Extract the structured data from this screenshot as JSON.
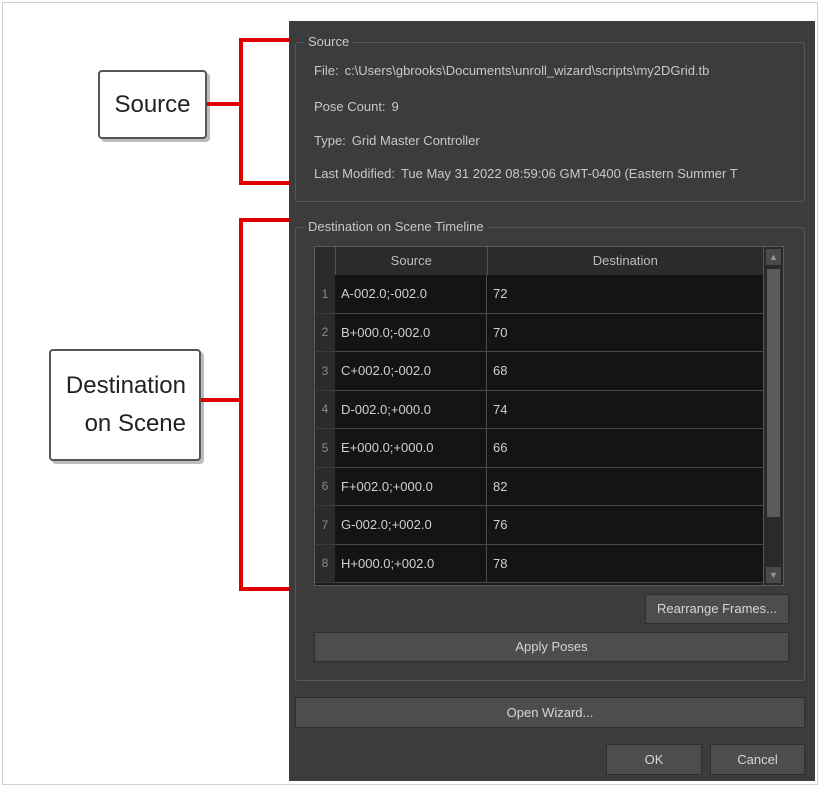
{
  "annotations": {
    "source_label": "Source",
    "destination_line1": "Destination",
    "destination_line2": "on Scene",
    "bracket_color": "#e00000"
  },
  "source_group": {
    "title": "Source",
    "file_label": "File:",
    "file_value": "c:\\Users\\gbrooks\\Documents\\unroll_wizard\\scripts\\my2DGrid.tb",
    "pose_count_label": "Pose Count:",
    "pose_count_value": "9",
    "type_label": "Type:",
    "type_value": "Grid Master Controller",
    "last_modified_label": "Last Modified:",
    "last_modified_value": "Tue May 31 2022 08:59:06 GMT-0400 (Eastern Summer T"
  },
  "destination_group": {
    "title": "Destination on Scene Timeline",
    "columns": [
      "Source",
      "Destination"
    ],
    "rows": [
      {
        "num": "1",
        "source": "A-002.0;-002.0",
        "destination": "72"
      },
      {
        "num": "2",
        "source": "B+000.0;-002.0",
        "destination": "70"
      },
      {
        "num": "3",
        "source": "C+002.0;-002.0",
        "destination": "68"
      },
      {
        "num": "4",
        "source": "D-002.0;+000.0",
        "destination": "74"
      },
      {
        "num": "5",
        "source": "E+000.0;+000.0",
        "destination": "66"
      },
      {
        "num": "6",
        "source": "F+002.0;+000.0",
        "destination": "82"
      },
      {
        "num": "7",
        "source": "G-002.0;+002.0",
        "destination": "76"
      },
      {
        "num": "8",
        "source": "H+000.0;+002.0",
        "destination": "78"
      }
    ],
    "rearrange_button": "Rearrange Frames...",
    "apply_button": "Apply Poses"
  },
  "footer": {
    "open_wizard_button": "Open Wizard...",
    "ok_button": "OK",
    "cancel_button": "Cancel"
  },
  "icons": {
    "scroll_up": "scroll-up-arrow-icon",
    "scroll_down": "scroll-down-arrow-icon"
  }
}
